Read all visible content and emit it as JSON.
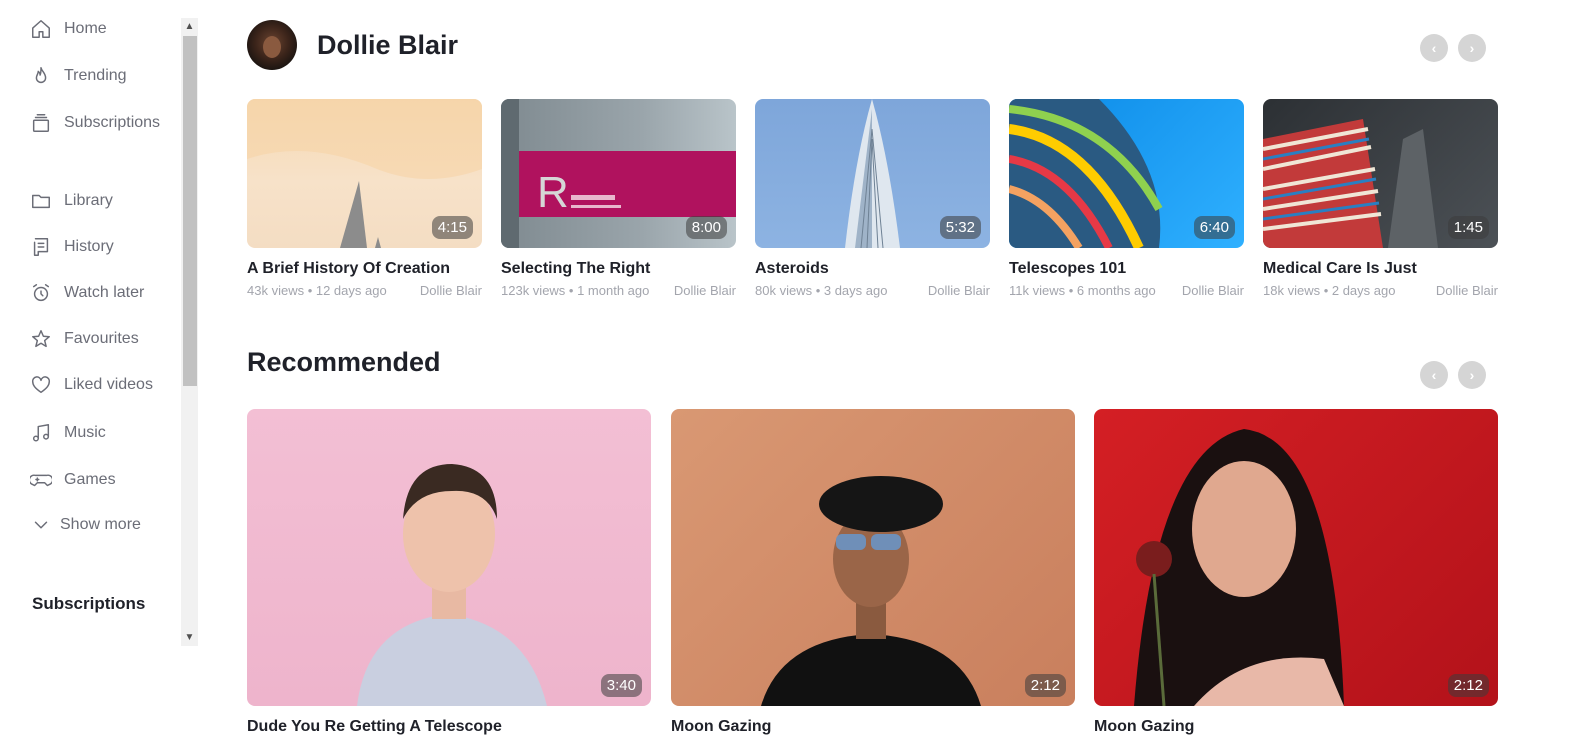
{
  "sidebar": {
    "items": [
      {
        "label": "Home",
        "icon": "home-icon"
      },
      {
        "label": "Trending",
        "icon": "flame-icon"
      },
      {
        "label": "Subscriptions",
        "icon": "subscriptions-icon"
      },
      {
        "label": "Library",
        "icon": "folder-icon"
      },
      {
        "label": "History",
        "icon": "history-icon"
      },
      {
        "label": "Watch later",
        "icon": "alarm-clock-icon"
      },
      {
        "label": "Favourites",
        "icon": "star-icon"
      },
      {
        "label": "Liked videos",
        "icon": "heart-icon"
      },
      {
        "label": "Music",
        "icon": "music-note-icon"
      },
      {
        "label": "Games",
        "icon": "gamepad-icon"
      },
      {
        "label": "Show more",
        "icon": "chevron-down-icon"
      }
    ],
    "subscriptions_heading": "Subscriptions"
  },
  "channel": {
    "name": "Dollie Blair",
    "videos": [
      {
        "title": "A Brief History Of Creation",
        "views": "43k views",
        "age": "12 days ago",
        "author": "Dollie Blair",
        "duration": "4:15"
      },
      {
        "title": "Selecting The Right",
        "views": "123k views",
        "age": "1 month ago",
        "author": "Dollie Blair",
        "duration": "8:00"
      },
      {
        "title": "Asteroids",
        "views": "80k views",
        "age": "3 days ago",
        "author": "Dollie Blair",
        "duration": "5:32"
      },
      {
        "title": "Telescopes 101",
        "views": "11k views",
        "age": "6 months ago",
        "author": "Dollie Blair",
        "duration": "6:40"
      },
      {
        "title": "Medical Care Is Just",
        "views": "18k views",
        "age": "2 days ago",
        "author": "Dollie Blair",
        "duration": "1:45"
      }
    ]
  },
  "recommended": {
    "title": "Recommended",
    "videos": [
      {
        "title": "Dude You Re Getting A Telescope",
        "duration": "3:40"
      },
      {
        "title": "Moon Gazing",
        "duration": "2:12"
      },
      {
        "title": "Moon Gazing",
        "duration": "2:12"
      }
    ]
  },
  "meta_separator": " • "
}
